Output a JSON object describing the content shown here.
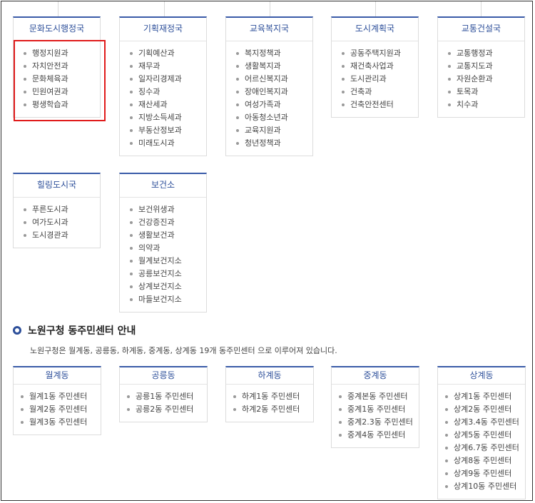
{
  "bureaus": [
    {
      "title": "문화도시행정국",
      "items": [
        "행정지원과",
        "자치안전과",
        "문화체육과",
        "민원여권과",
        "평생학습과"
      ]
    },
    {
      "title": "기획재정국",
      "items": [
        "기획예산과",
        "재무과",
        "일자리경제과",
        "징수과",
        "재산세과",
        "지방소득세과",
        "부동산정보과",
        "미래도시과"
      ]
    },
    {
      "title": "교육복지국",
      "items": [
        "복지정책과",
        "생활복지과",
        "어르신복지과",
        "장애인복지과",
        "여성가족과",
        "아동청소년과",
        "교육지원과",
        "청년정책과"
      ]
    },
    {
      "title": "도시계획국",
      "items": [
        "공동주택지원과",
        "재건축사업과",
        "도시관리과",
        "건축과",
        "건축안전센터"
      ]
    },
    {
      "title": "교통건설국",
      "items": [
        "교통행정과",
        "교통지도과",
        "자원순환과",
        "토목과",
        "치수과"
      ]
    },
    {
      "title": "힐링도시국",
      "items": [
        "푸른도시과",
        "여가도시과",
        "도시경관과"
      ]
    },
    {
      "title": "보건소",
      "items": [
        "보건위생과",
        "건강증진과",
        "생활보건과",
        "의약과",
        "월계보건지소",
        "공릉보건지소",
        "상계보건지소",
        "마들보건지소"
      ]
    }
  ],
  "section": {
    "title": "노원구청 동주민센터 안내",
    "description": "노원구청은 월계동, 공릉동, 하계동, 중계동, 상계동 19개 동주민센터 으로 이루어져 있습니다."
  },
  "dongs": [
    {
      "title": "월계동",
      "items": [
        "월계1동 주민센터",
        "월계2동 주민센터",
        "월계3동 주민센터"
      ]
    },
    {
      "title": "공릉동",
      "items": [
        "공릉1동 주민센터",
        "공릉2동 주민센터"
      ]
    },
    {
      "title": "하계동",
      "items": [
        "하계1동 주민센터",
        "하계2동 주민센터"
      ]
    },
    {
      "title": "중계동",
      "items": [
        "중계본동 주민센터",
        "중계1동 주민센터",
        "중계2.3동 주민센터",
        "중계4동 주민센터"
      ]
    },
    {
      "title": "상계동",
      "items": [
        "상계1동 주민센터",
        "상계2동 주민센터",
        "상계3.4동 주민센터",
        "상계5동 주민센터",
        "상계6.7동 주민센터",
        "상계8동 주민센터",
        "상계9동 주민센터",
        "상계10동 주민센터"
      ]
    }
  ],
  "colors": {
    "accent": "#3a5ba8",
    "highlight": "#e01b1b"
  }
}
